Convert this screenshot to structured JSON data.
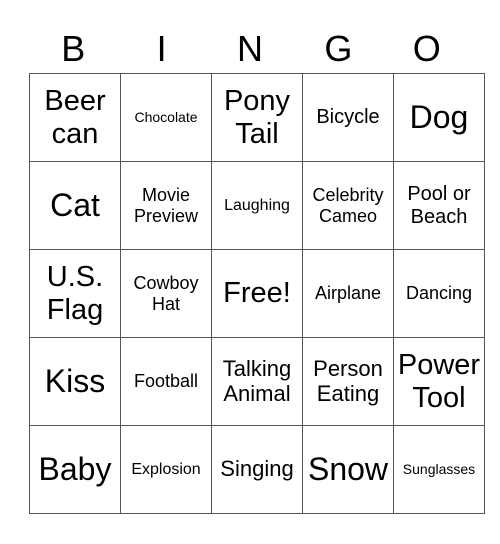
{
  "header": {
    "letters": [
      "B",
      "I",
      "N",
      "G",
      "O"
    ]
  },
  "board": {
    "rows": [
      [
        "Beer can",
        "Chocolate",
        "Pony Tail",
        "Bicycle",
        "Dog"
      ],
      [
        "Cat",
        "Movie Preview",
        "Laughing",
        "Celebrity Cameo",
        "Pool or Beach"
      ],
      [
        "U.S. Flag",
        "Cowboy Hat",
        "Free!",
        "Airplane",
        "Dancing"
      ],
      [
        "Kiss",
        "Football",
        "Talking Animal",
        "Person Eating",
        "Power Tool"
      ],
      [
        "Baby",
        "Explosion",
        "Singing",
        "Snow",
        "Sunglasses"
      ]
    ],
    "free_space": "Free!"
  }
}
